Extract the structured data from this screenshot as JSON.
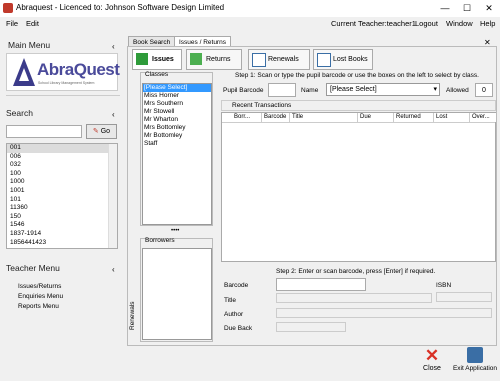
{
  "window": {
    "title": "Abraquest - Licenced to: Johnson Software Design Limited",
    "minimize": "—",
    "maximize": "☐",
    "close": "✕"
  },
  "menubar": {
    "file": "File",
    "edit": "Edit",
    "current_teacher": "Current Teacher:teacher1",
    "logout": "Logout",
    "window": "Window",
    "help": "Help"
  },
  "left": {
    "main_menu": "Main Menu",
    "logo_text": "AbraQuest",
    "logo_sub": "School Library Management System",
    "search_header": "Search",
    "go": "Go",
    "search_results": [
      "001",
      "006",
      "032",
      "100",
      "1000",
      "1001",
      "101",
      "11360",
      "150",
      "1546",
      "1837-1914",
      "1856441423"
    ],
    "teacher_menu": "Teacher Menu",
    "teacher_items": [
      "Issues/Returns",
      "Enquiries Menu",
      "Reports Menu"
    ]
  },
  "tabs": [
    "Book Search",
    "Issues / Returns"
  ],
  "subtabs": [
    "Issues",
    "Returns",
    "Renewals",
    "Lost Books"
  ],
  "classes": {
    "label": "Classes",
    "items": [
      "[Please Select]",
      "Miss Horner",
      "Mrs Southern",
      "Mr Stowell",
      "Mr Wharton",
      "Mrs Bottomley",
      "Mr Bottomley",
      "Staff"
    ]
  },
  "borrowers_label": "Borrowers",
  "renewals_vertical": "Renewals",
  "step1": "Step 1: Scan or type the pupil barcode or use the boxes on the left to select by class.",
  "pupil_barcode_label": "Pupil Barcode",
  "name_label": "Name",
  "name_value": "[Please Select]",
  "allowed_label": "Allowed",
  "allowed_value": "0",
  "recent_transactions": "Recent Transactions",
  "grid_cols": [
    "Borr...",
    "Barcode",
    "Title",
    "Due",
    "Returned",
    "Lost",
    "Over..."
  ],
  "step2": "Step 2: Enter or scan barcode, press [Enter] if required.",
  "barcode_label": "Barcode",
  "isbn_label": "ISBN",
  "title_label": "Title",
  "author_label": "Author",
  "dueback_label": "Due Back",
  "close_label": "Close",
  "exit_label": "Exit Application",
  "colors": {
    "accent": "#3399ff",
    "close_red": "#d93025",
    "logo": "#4a4a9a"
  }
}
